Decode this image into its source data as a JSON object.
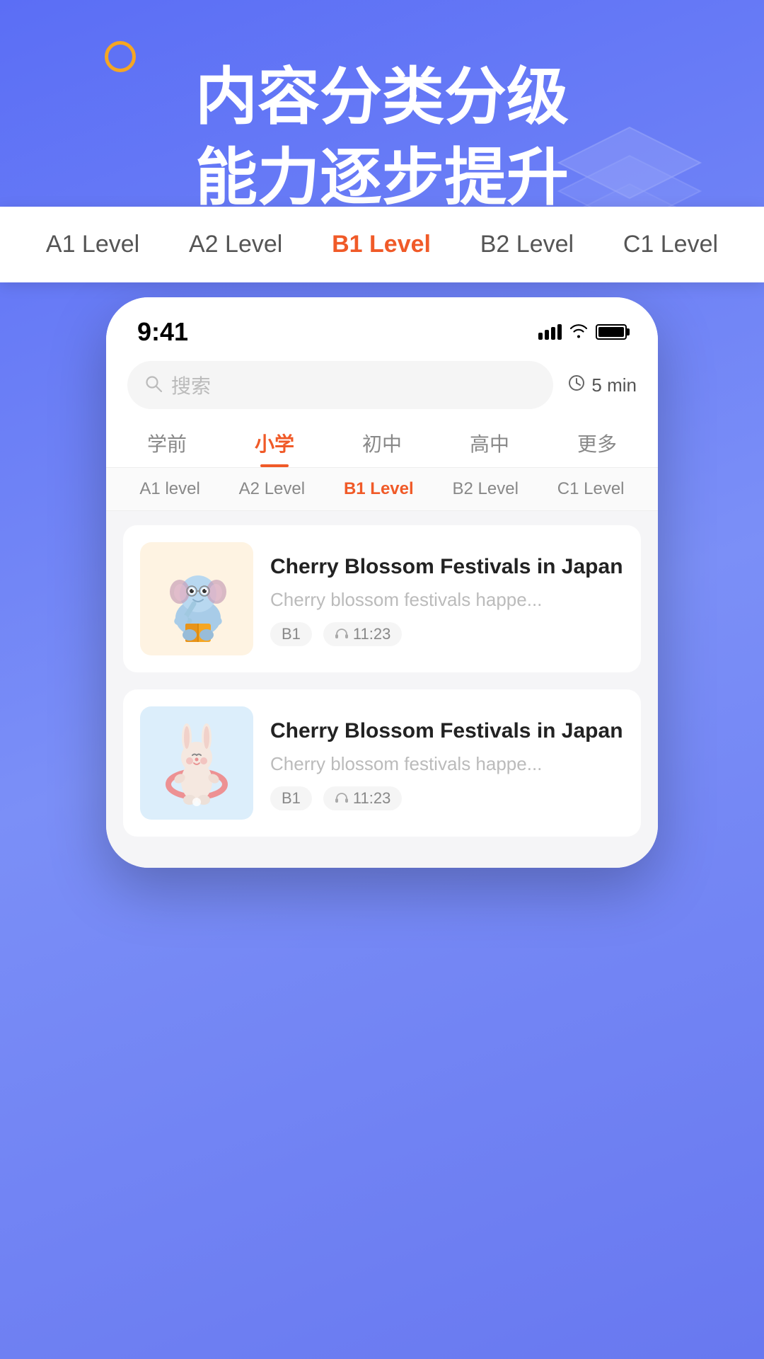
{
  "background": {
    "gradient_start": "#5b6ef5",
    "gradient_end": "#6878f0"
  },
  "hero": {
    "line1": "内容分类分级",
    "line2": "能力逐步提升"
  },
  "status_bar": {
    "time": "9:41",
    "signal_label": "signal",
    "wifi_label": "wifi",
    "battery_label": "battery"
  },
  "search": {
    "placeholder": "搜索",
    "time_filter": "5 min"
  },
  "category_tabs": [
    {
      "id": "preschool",
      "label": "学前",
      "active": false
    },
    {
      "id": "primary",
      "label": "小学",
      "active": true
    },
    {
      "id": "middle",
      "label": "初中",
      "active": false
    },
    {
      "id": "high",
      "label": "高中",
      "active": false
    },
    {
      "id": "more",
      "label": "更多",
      "active": false
    }
  ],
  "level_overlay": {
    "items": [
      {
        "id": "a1",
        "label": "A1 Level",
        "active": false
      },
      {
        "id": "a2",
        "label": "A2 Level",
        "active": false
      },
      {
        "id": "b1",
        "label": "B1 Level",
        "active": true
      },
      {
        "id": "b2",
        "label": "B2 Level",
        "active": false
      },
      {
        "id": "c1",
        "label": "C1 Level",
        "active": false
      }
    ]
  },
  "sub_level_bar": {
    "items": [
      {
        "id": "a1",
        "label": "A1 level",
        "active": false
      },
      {
        "id": "a2",
        "label": "A2 Level",
        "active": false
      },
      {
        "id": "b1",
        "label": "B1 Level",
        "active": true
      },
      {
        "id": "b2",
        "label": "B2 Level",
        "active": false
      },
      {
        "id": "c1",
        "label": "C1 Level",
        "active": false
      }
    ]
  },
  "content_cards": [
    {
      "id": "card1",
      "title": "Cherry Blossom Festivals in Japan",
      "description": "Cherry blossom festivals happe...",
      "level": "B1",
      "duration": "11:23",
      "thumbnail_type": "elephant"
    },
    {
      "id": "card2",
      "title": "Cherry Blossom Festivals in Japan",
      "description": "Cherry blossom festivals happe...",
      "level": "B1",
      "duration": "11:23",
      "thumbnail_type": "bunny"
    }
  ],
  "accent_color": "#f05a28",
  "primary_color": "#5b6ef5"
}
